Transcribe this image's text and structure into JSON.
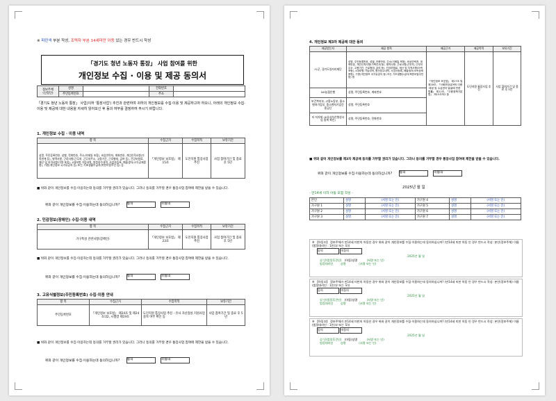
{
  "page1": {
    "notice": "※ 파란색 부분 작성, 조력자 부분 14세미만 아동 있는 경우 반드시 작성",
    "notice_parts": {
      "prefix": "※",
      "blue": "파란색",
      "mid": " 부분 작성, ",
      "red": "조력자 부분 14세미만 아동",
      "suffix": " 있는 경우 반드시 작성"
    },
    "title_line1": "「경기도 청년 노동자 통장」 사업 참여를 위한",
    "title_line2": "개인정보 수집 · 이용 및 제공 동의서",
    "applicant": {
      "label1": "정보주체",
      "label2": "(신청인)",
      "name_label": "성명",
      "rrn_label": "주민등록번호",
      "phone_label": "전화번호",
      "addr_label": "주소"
    },
    "intro": "「경기도 청년 노동자 통장」 사업(이하 '통장사업') 추진과 관련하여 귀하의 개인정보를 수집·이용 및 제공하고자 하오니, 아래의 개인정보 수집·이용 및 제공에 대한 내용을 자세히 읽어보신 후 동의 여부를 결정하여 주시기 바랍니다.",
    "s1": {
      "heading": "1. 개인정보 수집 · 이용 내역",
      "headers": [
        "항 목",
        "수집근거",
        "수집목적",
        "보유기간"
      ],
      "item": "성명, 주민등록번호, 성별, 전화번호, 주소(이메일 포함), 비상연락처, 계좌번호, 개인인적사항(가족관계 등), 병역사항, 근로사항(근무처, 근무처주소, 고용기간, 근로형태, 급여 등), 건강보험료, 재산 및 자격사항(이력 포함), 4대보험 가입내역, 원천징수내역, 사업자등록, 폐출생자(소득공제증명), 기명(개인정보 국가유공자 등) 또는 기초생활수급자(북한이탈주민 등) 등",
      "basis": "「개인정보 보호법」 제15조",
      "purpose": "도민지원 통장사업 추진",
      "retention": "사업 참여기간 및 종료 후 5년"
    },
    "s1_notice": "■ 위와 같이 개인정보를 수집·이용하는데 동의를 거부할 권리가 있습니다. 그러나 동의를 거부할 경우 통장사업 참여에 제한을 받을 수 있습니다.",
    "s1_q": "위와 같이 개인정보를 수집·이용하는데 동의하십니까?",
    "agree": "동의",
    "disagree": "미동의",
    "s2": {
      "heading": "2. 민감정보(장애인) 수집·이용 내역",
      "headers": [
        "항 목",
        "수집근거",
        "수집목적",
        "보유기간"
      ],
      "item": "가구특성 관련사항(장애인)",
      "basis": "「개인정보 보호법」 제23조",
      "purpose": "도민지원 통장사업 추진",
      "retention": "사업 참여기간 및 종료 후 5년"
    },
    "s2_notice": "■ 위와 같이 개인정보를 수집·이용하는데 동의를 거부할 권리가 있습니다. 그러나 동의를 거부할 경우 통장사업 참여에 제한을 받을 수 있습니다.",
    "s2_q": "위와 같이 개인정보를 수집·이용하는데 동의하십니까?",
    "s3": {
      "heading": "3. 고유식별정보(주민등록번호) 수집·이용 안내",
      "headers": [
        "항 목",
        "수집근거",
        "수집목적",
        "보유기간"
      ],
      "item": "주민등록번호",
      "basis": "「개인정보 보호법」 제24조 및 제24조의2, 시행령 제19조",
      "purpose": "도민지원 통장사업 추진 - 유사 자산형성 지원사업 중복 여부 확인 등",
      "retention": "사업 참여기간 및 종료 후 5년"
    },
    "s3_notice": "■ 위와 같이 개인정보를 수집·이용하는데 동의를 거부할 권리가 있습니다. 그러나 동의를 거부할 경우 통장사업 참여에 제한을 받을 수 있습니다.",
    "s3_q": "위와 같이 개인정보를 수집·이용하는데 동의하십니까?"
  },
  "page2": {
    "heading": "4. 개인정보 제3자 제공에 대한 동의",
    "headers": [
      "제공받는자",
      "제공 항목",
      "제공근거",
      "제공목적",
      "보유기간"
    ],
    "rows": [
      {
        "who": "시·군, 경기도일자리재단",
        "items": "성명, 주민등록번호, 성별, 전화번호, 주소(이메일 포함), 비상연락처, 계좌번호, 개인인적사항(가족관계 등), 병역사항, 근로사항(근무처, 근무처주소, 고용기간, 근로형태, 급여 등), 건강보험료, 재산 및 자격사항(이력 포함), 4대보험 가입내역, 원천징수내역, 사업자등록, 폐출생자(소득공제증명), 기명(개인정보 국가유공자 등) 또는 기초생활수급자(북한이탈주민 등) 등"
      },
      {
        "who": "NH농협은행",
        "items": "성명, 주민등록번호, 계좌번호"
      },
      {
        "who": "보건복지부, 고용노동부, 중소벤처기업부, 중소벤처기업진흥공단",
        "items": "성명, 주민등록번호"
      },
      {
        "who": "타 지자체 (※유사자산형성사업 중복 확인)",
        "items": "성명, 주민등록번호, 전화번호"
      }
    ],
    "basis": "「개인정보 보호법」 제17조 및 제18조, 「사회보장급여의 이용·제공 및 수급권자 발굴에 관한 법률」 제12조, 「고용정책기본법」 제15조의2 등",
    "purpose": "도민지원 통장사업 추진",
    "retention": "사업 참여기간 및 종료 후 5년",
    "notice": "■ 위와 같이 개인정보를 제3자 제공에 동의를 거부할 권리가 있습니다. 그러나 동의를 거부할 경우 통장사업 참여에 제한을 받을 수 있습니다.",
    "q": "위와 같이 개인정보를 수집·이용하는데 동의하십니까?",
    "date_line": "2025년      월      일",
    "under14": "- 만14세 이하 아동 포함 작성 -",
    "sign_rows": [
      [
        "본인",
        "성명",
        "(서명 또는 인)",
        "가구원 4",
        "성명",
        "(서명 또는 인)"
      ],
      [
        "가구원 1",
        "성명",
        "(서명 또는 인)",
        "가구원 5",
        "성명",
        "(서명 또는 인)"
      ],
      [
        "가구원 2",
        "성명",
        "(서명 또는 인)",
        "가구원 6",
        "성명",
        "(서명 또는 인)"
      ],
      [
        "가구원 3",
        "성명",
        "(서명 또는 인)",
        "가구원 7",
        "성명",
        "(서명 또는 인)"
      ]
    ],
    "child_blocks": [
      {
        "text": "※ 【아동①】 정보주체가 만14세 미만의 아동인 경우 위와 같이 개인정보를 수집·이용하는데 동의하십니까? (만14세 미만 아동 인 경우 반드시 작성: 본인(정보주체) 이름(법정대리인 : 1인(부 또는 모))",
        "date": "2025년      월      일",
        "child": "성 인(법정후견인)",
        "child_name": "(아동)성명",
        "child_sign": "(서명 또는 인)",
        "rep": "법정대리인",
        "rep_name": "성명",
        "rep_sign": "(서명 또는 인)"
      },
      {
        "text": "※ 【아동②】 정보주체가 만14세 미만의 아동인 경우 위와 같이 개인정보를 수집·이용하는데 동의하십니까? (만14세 미만 아동 인 경우 반드시 작성: 본인(정보주체) 이름(법정대리인 : 1인(부 또는 모))",
        "date": "2025년      월      일",
        "child": "성 인(법정후견인)",
        "child_name": "(아동)성명",
        "child_sign": "(서명 또는 인)",
        "rep": "법정대리인",
        "rep_name": "성명",
        "rep_sign": "(서명 또는 인)"
      },
      {
        "text": "※ 【아동③】 정보주체가 만14세 미만의 아동인 경우 위와 같이 개인정보를 수집·이용하는데 동의하십니까? (만14세 미만 아동 인 경우 반드시 작성: 본인(정보주체) 이름(법정대리인 : 1인(부 또는 모))",
        "date": "2025년      월      일",
        "child": "성 인(법정후견인)",
        "child_name": "(아동)성명",
        "child_sign": "(서명 또는 인)",
        "rep": "법정대리인",
        "rep_name": "성명",
        "rep_sign": "(서명 또는 인)"
      }
    ]
  },
  "colors": {
    "blue": "#2a4fc0",
    "red": "#d22222",
    "green": "#2a8a3a",
    "page": "#ffffff",
    "bg": "#eaeaea"
  }
}
